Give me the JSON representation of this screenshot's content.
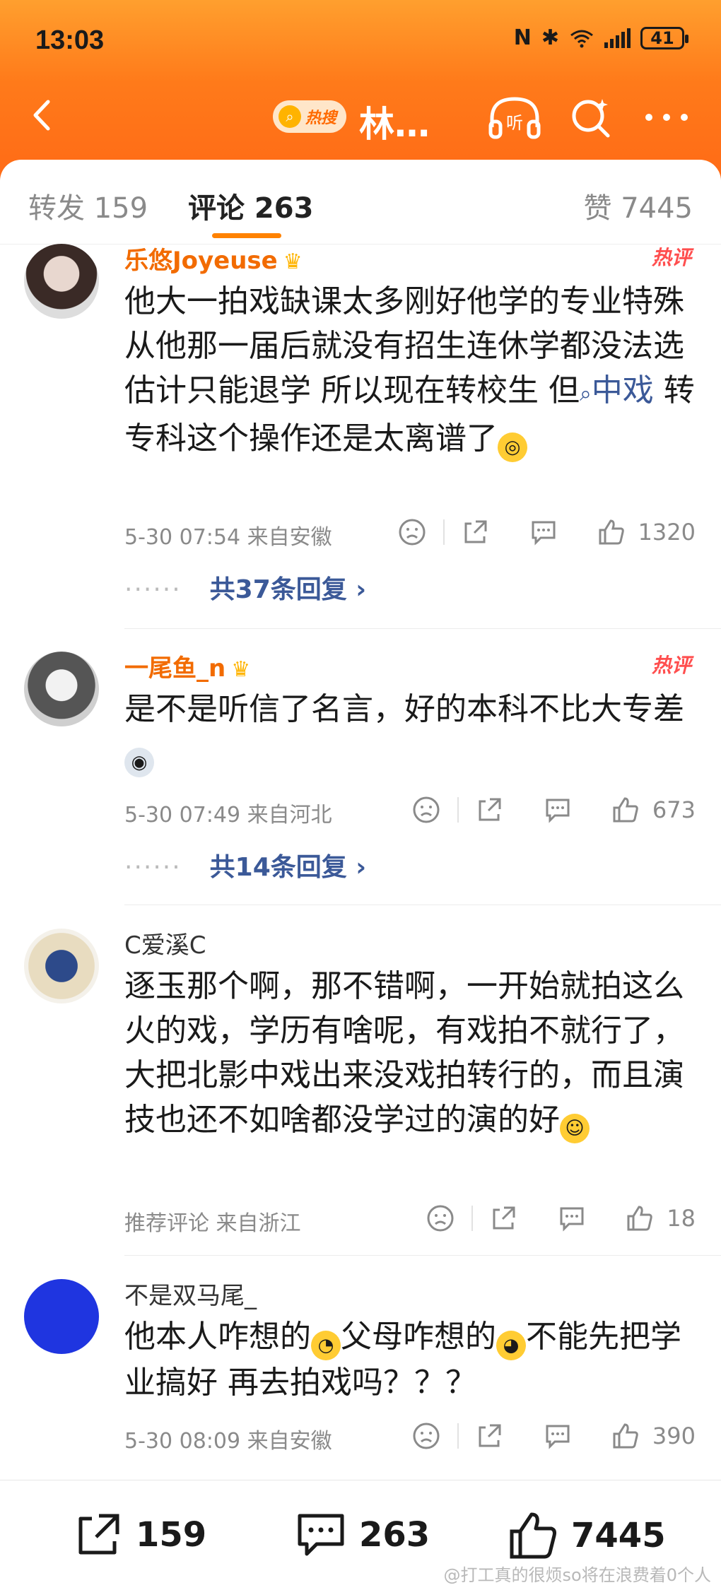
{
  "status_bar": {
    "time": "13:03",
    "battery": "41"
  },
  "nav": {
    "hot_badge": "热搜",
    "title": "林…"
  },
  "tabs": {
    "repost": "转发 159",
    "comments": "评论 263",
    "likes": "赞 7445"
  },
  "comments": [
    {
      "username": "乐悠Joyeuse",
      "hot_tag": "热评",
      "text_before": "他大一拍戏缺课太多刚好他学的专业特殊从他那一届后就没有招生连休学都没法选 估计只能退学 所以现在转校生  但",
      "topic": "中戏",
      "text_after": " 转专科这个操作还是太离谱了",
      "meta": "5-30 07:54  来自安徽",
      "likes": "1320",
      "replies": "共37条回复 ›"
    },
    {
      "username": "一尾鱼_n",
      "hot_tag": "热评",
      "text": "是不是听信了名言，好的本科不比大专差",
      "meta": "5-30 07:49  来自河北",
      "likes": "673",
      "replies": "共14条回复 ›"
    },
    {
      "username": "C爱溪C",
      "text": "逐玉那个啊，那不错啊，一开始就拍这么火的戏，学历有啥呢，有戏拍不就行了，大把北影中戏出来没戏拍转行的，而且演技也还不如啥都没学过的演的好",
      "meta": "推荐评论  来自浙江",
      "likes": "18"
    },
    {
      "username": "不是双马尾_",
      "text_a": "他本人咋想的",
      "text_b": "父母咋想的",
      "text_c": "不能先把学业搞好 再去拍戏吗？？？",
      "meta": "5-30 08:09  来自安徽",
      "likes": "390"
    }
  ],
  "bottom_bar": {
    "reposts": "159",
    "comments": "263",
    "likes": "7445",
    "watermark": "@打工真的很烦so将在浪费着0个人"
  },
  "colors": {
    "header": "#ff7a1a",
    "accent": "#ff8200",
    "link": "#3b5998",
    "hot": "#ff4e4e",
    "vip_name": "#f26b00"
  }
}
